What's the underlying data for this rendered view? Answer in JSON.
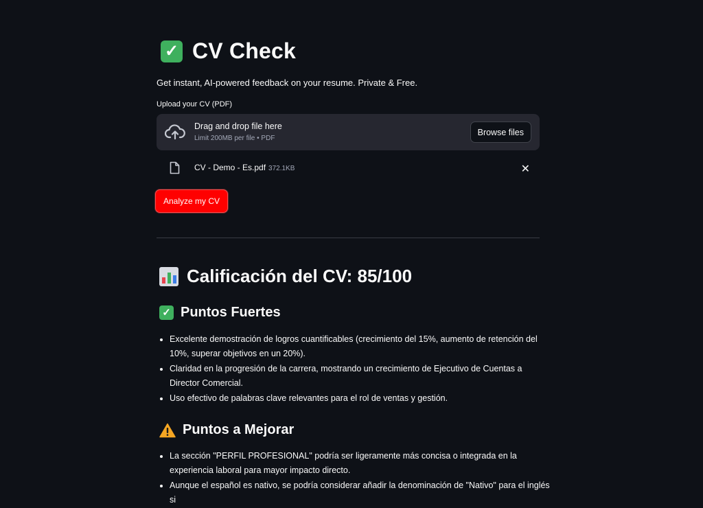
{
  "header": {
    "title": "CV Check",
    "subtitle": "Get instant, AI-powered feedback on your resume. Private & Free."
  },
  "uploader": {
    "label": "Upload your CV (PDF)",
    "drop_text": "Drag and drop file here",
    "limit_text": "Limit 200MB per file • PDF",
    "browse_label": "Browse files",
    "file": {
      "name": "CV - Demo - Es.pdf",
      "size": "372.1KB"
    }
  },
  "actions": {
    "analyze_label": "Analyze my CV"
  },
  "results": {
    "score_heading": "Calificación del CV: 85/100",
    "strengths_heading": "Puntos Fuertes",
    "strengths": [
      "Excelente demostración de logros cuantificables (crecimiento del 15%, aumento de retención del 10%, superar objetivos en un 20%).",
      "Claridad en la progresión de la carrera, mostrando un crecimiento de Ejecutivo de Cuentas a Director Comercial.",
      "Uso efectivo de palabras clave relevantes para el rol de ventas y gestión."
    ],
    "improve_heading": "Puntos a Mejorar",
    "improvements": [
      "La sección \"PERFIL PROFESIONAL\" podría ser ligeramente más concisa o integrada en la experiencia laboral para mayor impacto directo.",
      "Aunque el español es nativo, se podría considerar añadir la denominación de \"Nativo\" para el inglés si"
    ]
  },
  "colors": {
    "background": "#0e1117",
    "panel": "#262730",
    "primary_button": "#ff0000",
    "check_emoji": "#3fb05e",
    "warning_emoji": "#f5a623"
  },
  "icons": [
    "check-mark-emoji",
    "cloud-upload-icon",
    "file-icon",
    "close-icon",
    "bar-chart-emoji",
    "warning-emoji"
  ]
}
